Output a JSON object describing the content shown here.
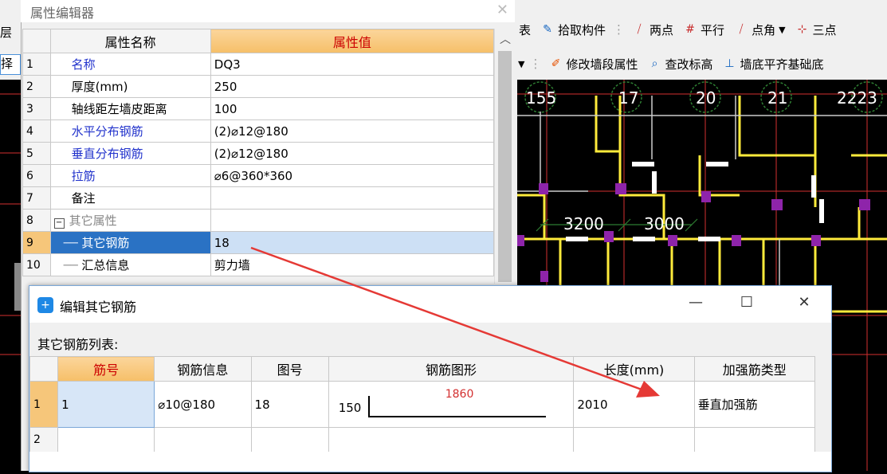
{
  "toolbar_right": {
    "row1": [
      {
        "icon": "table-icon",
        "label": "表"
      },
      {
        "icon": "pick-icon",
        "label": "拾取构件"
      },
      {
        "icon": "two-point-icon",
        "label": "两点"
      },
      {
        "icon": "parallel-icon",
        "label": "平行"
      },
      {
        "icon": "point-angle-icon",
        "label": "点角"
      },
      {
        "icon": "three-point-icon",
        "label": "三点"
      }
    ],
    "row2": [
      {
        "icon": "edit-wall-icon",
        "label": "修改墙段属性"
      },
      {
        "icon": "check-elevation-icon",
        "label": "查改标高"
      },
      {
        "icon": "align-bottom-icon",
        "label": "墙底平齐基础底"
      }
    ]
  },
  "cad": {
    "axis_labels": [
      "155",
      "17",
      "20",
      "21",
      "2223"
    ],
    "dims": [
      "3200",
      "3000"
    ]
  },
  "left_strip": {
    "label1": "层",
    "label2": "择"
  },
  "property_editor": {
    "title": "属性编辑器",
    "col_name": "属性名称",
    "col_value": "属性值",
    "rows": [
      {
        "num": "1",
        "name": "名称",
        "value": "DQ3"
      },
      {
        "num": "2",
        "name": "厚度(mm)",
        "value": "250"
      },
      {
        "num": "3",
        "name": "轴线距左墙皮距离",
        "value": "100"
      },
      {
        "num": "4",
        "name": "水平分布钢筋",
        "value": "(2)⌀12@180"
      },
      {
        "num": "5",
        "name": "垂直分布钢筋",
        "value": "(2)⌀12@180"
      },
      {
        "num": "6",
        "name": "拉筋",
        "value": "⌀6@360*360"
      },
      {
        "num": "7",
        "name": "备注",
        "value": ""
      },
      {
        "num": "8",
        "name": "其它属性",
        "value": ""
      },
      {
        "num": "9",
        "name": "其它钢筋",
        "value": "18"
      },
      {
        "num": "10",
        "name": "汇总信息",
        "value": "剪力墙"
      }
    ]
  },
  "dialog": {
    "title": "编辑其它钢筋",
    "list_label": "其它钢筋列表:",
    "headers": [
      "筋号",
      "钢筋信息",
      "图号",
      "钢筋图形",
      "长度(mm)",
      "加强筋类型"
    ],
    "rows": [
      {
        "num": "1",
        "bar_no": "1",
        "info": "⌀10@180",
        "figure_no": "18",
        "shape_left": "150",
        "shape_len": "1860",
        "length": "2010",
        "type": "垂直加强筋"
      },
      {
        "num": "2",
        "bar_no": "",
        "info": "",
        "figure_no": "",
        "shape_left": "",
        "shape_len": "",
        "length": "",
        "type": ""
      }
    ]
  },
  "colors": {
    "accent_orange": "#f6bf68",
    "selection_blue": "#2a72c4",
    "arrow_red": "#e53935"
  }
}
